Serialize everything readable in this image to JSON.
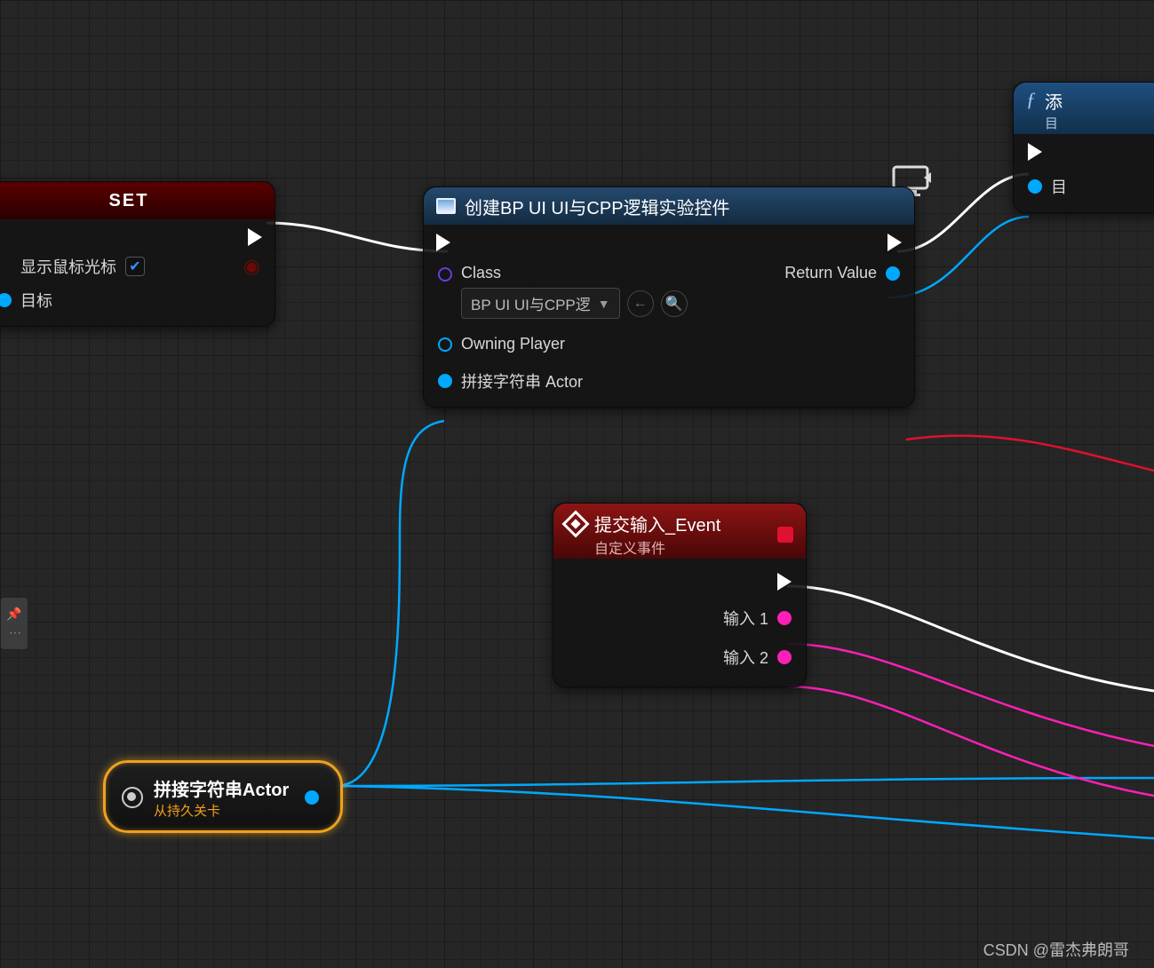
{
  "nodes": {
    "set": {
      "title": "SET",
      "inputs": {
        "show_cursor_label": "显示鼠标光标",
        "show_cursor_checked": true,
        "target_label": "目标"
      }
    },
    "create": {
      "title": "创建BP UI UI与CPP逻辑实验控件",
      "class_label": "Class",
      "class_value": "BP UI UI与CPP逻",
      "owning_player_label": "Owning Player",
      "actor_input_label": "拼接字符串 Actor",
      "return_label": "Return Value"
    },
    "event": {
      "title": "提交输入_Event",
      "subtitle": "自定义事件",
      "out1": "输入 1",
      "out2": "输入 2"
    },
    "func": {
      "title": "添",
      "subtitle": "目",
      "target_label": "目"
    },
    "var": {
      "title": "拼接字符串Actor",
      "subtitle": "从持久关卡"
    }
  },
  "watermark": "CSDN @雷杰弗朗哥"
}
